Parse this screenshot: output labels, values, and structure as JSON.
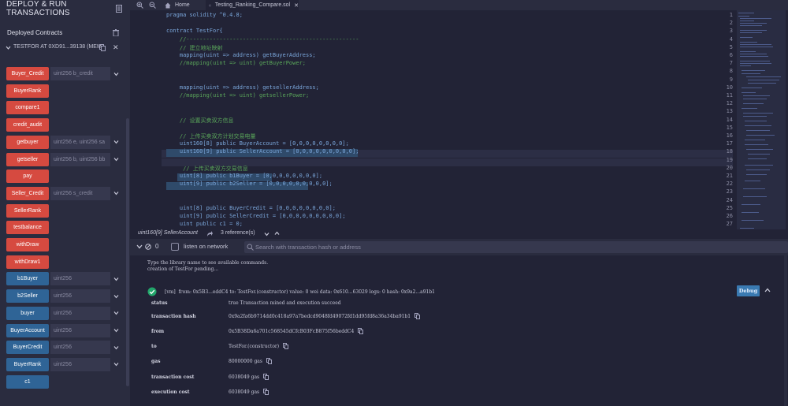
{
  "left": {
    "title": "DEPLOY & RUN TRANSACTIONS",
    "deployed_title": "Deployed Contracts",
    "instance_label": "TESTFOR AT 0XD91...39138 (MEM",
    "functions": [
      {
        "label": "Buyer_Credit",
        "color": "red",
        "input": "uint256 b_credit",
        "expand": true
      },
      {
        "label": "BuyerRank",
        "color": "red",
        "input": "",
        "expand": false
      },
      {
        "label": "compare1",
        "color": "red",
        "input": "",
        "expand": false
      },
      {
        "label": "credit_audit",
        "color": "red",
        "input": "",
        "expand": false
      },
      {
        "label": "getbuyer",
        "color": "red",
        "input": "uint256 e, uint256 sa",
        "expand": true
      },
      {
        "label": "getseller",
        "color": "red",
        "input": "uint256 b, uint256 bb",
        "expand": true
      },
      {
        "label": "pay",
        "color": "red",
        "input": "",
        "expand": false
      },
      {
        "label": "Seller_Credit",
        "color": "red",
        "input": "uint256 s_credit",
        "expand": true
      },
      {
        "label": "SellerRank",
        "color": "red",
        "input": "",
        "expand": false
      },
      {
        "label": "testbalance",
        "color": "red",
        "input": "",
        "expand": false
      },
      {
        "label": "withDraw",
        "color": "red",
        "input": "",
        "expand": false
      },
      {
        "label": "withDraw1",
        "color": "red",
        "input": "",
        "expand": false
      },
      {
        "label": "b1Buyer",
        "color": "blue",
        "input": "uint256",
        "expand": true
      },
      {
        "label": "b2Seller",
        "color": "blue",
        "input": "uint256",
        "expand": true
      },
      {
        "label": "buyer",
        "color": "blue",
        "input": "uint256",
        "expand": true
      },
      {
        "label": "BuyerAccount",
        "color": "blue",
        "input": "uint256",
        "expand": true
      },
      {
        "label": "BuyerCredit",
        "color": "blue",
        "input": "uint256",
        "expand": true
      },
      {
        "label": "BuyerRank",
        "color": "blue",
        "input": "uint256",
        "expand": true
      },
      {
        "label": "c1",
        "color": "blue",
        "input": "",
        "expand": false
      }
    ]
  },
  "tabs": {
    "home": "Home",
    "file": "Testing_Ranking_Compare.sol"
  },
  "editor": {
    "lines": [
      {
        "n": "1",
        "t": "pragma solidity ^0.4.8;",
        "k": "plain"
      },
      {
        "n": "2",
        "t": "",
        "k": "plain"
      },
      {
        "n": "3",
        "t": "contract TestFor{",
        "k": "plain"
      },
      {
        "n": "4",
        "t": "    //----------------------------------------------------",
        "k": "comment"
      },
      {
        "n": "5",
        "t": "    // 建立地址映射",
        "k": "comment"
      },
      {
        "n": "6",
        "t": "    mapping(uint => address) getBuyerAddress;",
        "k": "plain"
      },
      {
        "n": "7",
        "t": "    //mapping(uint => uint) getBuyerPower;",
        "k": "comment"
      },
      {
        "n": "8",
        "t": "",
        "k": "plain"
      },
      {
        "n": "9",
        "t": "",
        "k": "plain"
      },
      {
        "n": "10",
        "t": "    mapping(uint => address) getsellerAddress;",
        "k": "plain"
      },
      {
        "n": "11",
        "t": "    //mapping(uint => uint) getsellerPower;",
        "k": "comment"
      },
      {
        "n": "12",
        "t": "",
        "k": "plain"
      },
      {
        "n": "13",
        "t": "",
        "k": "plain"
      },
      {
        "n": "14",
        "t": "    // 设置买卖双方信息",
        "k": "comment"
      },
      {
        "n": "15",
        "t": "",
        "k": "plain"
      },
      {
        "n": "16",
        "t": "    // 上传买卖双方计划交易电量",
        "k": "comment"
      },
      {
        "n": "17",
        "t": "    uint160[8] public BuyerAccount = [0,0,0,0,0,0,0,0];",
        "k": "plain"
      },
      {
        "n": "18",
        "t": "    uint160[9] public SellerAccount = [0,0,0,0,0,0,0,0,0];",
        "k": "plain"
      },
      {
        "n": "19",
        "t": "",
        "k": "plain"
      },
      {
        "n": "20",
        "t": "     // 上传买卖双方交易信息",
        "k": "comment"
      },
      {
        "n": "21",
        "t": "    uint[8] public b1Buyer = [0,0,0,0,0,0,0,0];",
        "k": "plain"
      },
      {
        "n": "22",
        "t": "    uint[9] public b2Seller = [0,0,0,0,0,0,0,0,0];",
        "k": "plain"
      },
      {
        "n": "23",
        "t": "",
        "k": "plain"
      },
      {
        "n": "24",
        "t": "",
        "k": "plain"
      },
      {
        "n": "25",
        "t": "    uint[8] public BuyerCredit = [0,0,0,0,0,0,0,0];",
        "k": "plain"
      },
      {
        "n": "26",
        "t": "    uint[9] public SellerCredit = [0,0,0,0,0,0,0,0,0];",
        "k": "plain"
      },
      {
        "n": "27",
        "t": "    uint public c1 = 0;",
        "k": "plain"
      }
    ]
  },
  "refbar": {
    "signature": "uint160[9] SellerAccount",
    "references": "3 reference(s)"
  },
  "terminal": {
    "counter": "0",
    "listen_label": "listen on network",
    "search_placeholder": "Search with transaction hash or address",
    "intro1": "Type the library name to see available commands.",
    "intro2": "creation of TestFor pending...",
    "tx_summary": "[vm]  from: 0x5B3...eddC4 to: TestFor.(constructor) value: 0 wei data: 0x610...63029 logs: 0 hash: 0x9a2...a91b1",
    "debug_label": "Debug",
    "rows": [
      {
        "key": "status",
        "val": "true Transaction mined and execution succeed"
      },
      {
        "key": "transaction hash",
        "val": "0x9a2fa6b9714dd0c418a97a7bedcd9048fd49072fd1dd95fd8a36a34ba91b1"
      },
      {
        "key": "from",
        "val": "0x5B38Da6a701c568545dCfcB03FcB875f56beddC4"
      },
      {
        "key": "to",
        "val": "TestFor.(constructor)"
      },
      {
        "key": "gas",
        "val": "80000000 gas"
      },
      {
        "key": "transaction cost",
        "val": "6038049 gas"
      },
      {
        "key": "execution cost",
        "val": "6038049 gas"
      }
    ]
  },
  "colors": {
    "red_button": "#d64a40",
    "blue_button": "#2f6496",
    "panel_bg": "#2a2c3f",
    "editor_bg": "#222336",
    "success": "#22a66b",
    "debug": "#3a7ab2"
  }
}
